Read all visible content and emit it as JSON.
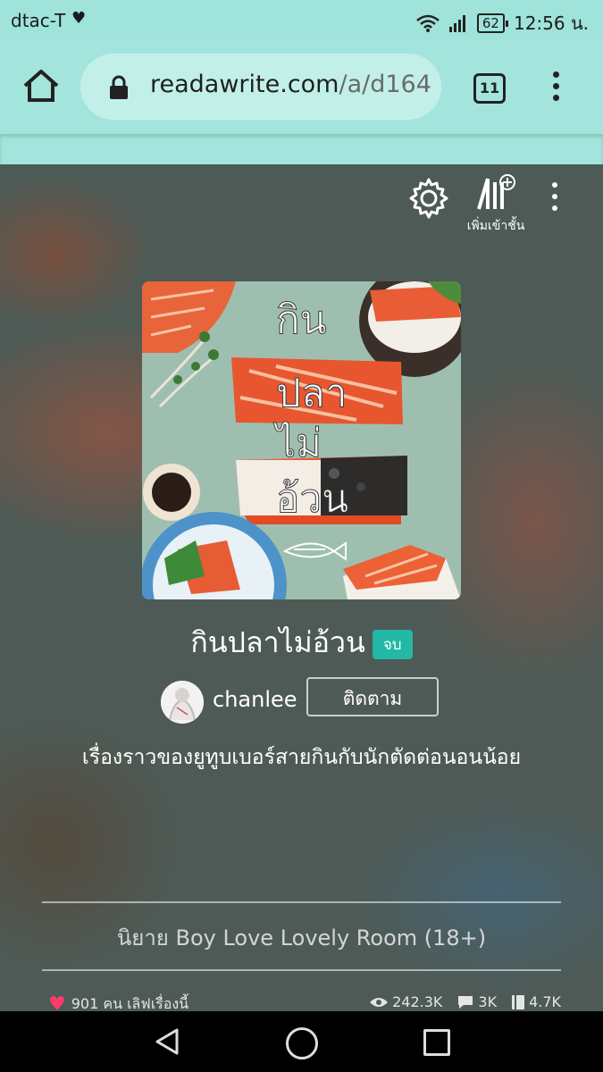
{
  "status_bar": {
    "carrier": "dtac-T",
    "battery": "62",
    "time": "12:56 น."
  },
  "browser": {
    "url_domain": "readawrite.com",
    "url_path": "/a/d164",
    "tab_count": "11"
  },
  "toolbar": {
    "add_shelf_label": "เพิ่มเข้าชั้น"
  },
  "novel": {
    "title": "กินปลาไม่อ้วน",
    "status_badge": "จบ",
    "author": "chanlee",
    "follow_label": "ติดตาม",
    "description": "เรื่องราวของยูทูบเบอร์สายกินกับนักตัดต่อนอนน้อย",
    "category": "นิยาย Boy Love Lovely Room (18+)",
    "cover_title_lines": [
      "กิน",
      "ปลา",
      "ไม่",
      "อ้วน"
    ]
  },
  "stats": {
    "likes_text": "901 คน เลิฟเรื่องนี้",
    "views": "242.3K",
    "comments": "3K",
    "chapters": "4.7K"
  }
}
